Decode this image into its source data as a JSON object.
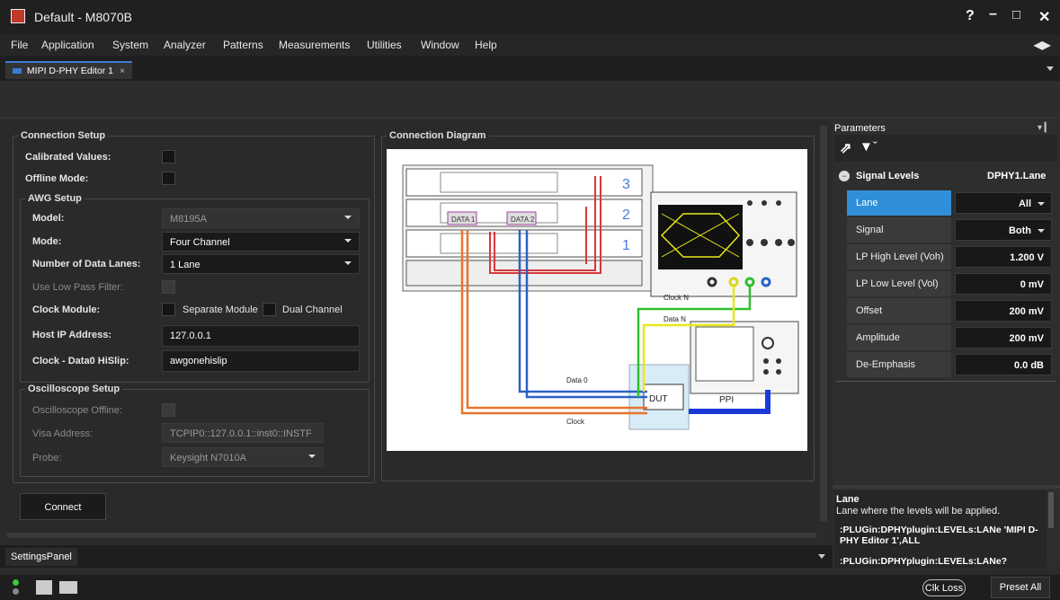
{
  "window": {
    "title": "Default - M8070B",
    "help": "?",
    "minimize": "–",
    "maximize": "□",
    "close": "✕"
  },
  "menu": [
    "File",
    "Application",
    "System",
    "Analyzer",
    "Patterns",
    "Measurements",
    "Utilities",
    "Window",
    "Help"
  ],
  "tab": {
    "label": "MIPI D-PHY Editor 1",
    "close": "×"
  },
  "connection_setup": {
    "title": "Connection Setup",
    "calibrated_label": "Calibrated Values:",
    "offline_label": "Offline Mode:",
    "awg": {
      "title": "AWG Setup",
      "model_label": "Model:",
      "model_value": "M8195A",
      "mode_label": "Mode:",
      "mode_value": "Four Channel",
      "lanes_label": "Number of Data Lanes:",
      "lanes_value": "1 Lane",
      "lowpass_label": "Use Low Pass Filter:",
      "clock_label": "Clock Module:",
      "separate_module": "Separate Module",
      "dual_channel": "Dual Channel",
      "host_label": "Host IP Address:",
      "host_value": "127.0.0.1",
      "hislip_label": "Clock - Data0 HiSlip:",
      "hislip_value": "awgonehislip"
    },
    "scope": {
      "title": "Oscilloscope Setup",
      "offline_label": "Oscilloscope Offline:",
      "visa_label": "Visa Address:",
      "visa_value": "TCPIP0::127.0.0.1::inst0::INSTF",
      "probe_label": "Probe:",
      "probe_value": "Keysight N7010A"
    },
    "connect_label": "Connect"
  },
  "diagram": {
    "title": "Connection Diagram",
    "data1": "DATA 1",
    "data2": "DATA 2",
    "clock_n": "Clock N",
    "data_n": "Data N",
    "data_0": "Data 0",
    "clock": "Clock",
    "dut": "DUT",
    "ppi": "PPI",
    "rack_numbers": [
      "3",
      "2",
      "1"
    ]
  },
  "parameters": {
    "title": "Parameters",
    "section": "Signal Levels",
    "section_value": "DPHY1.Lane",
    "rows": [
      {
        "name": "Lane",
        "value": "All"
      },
      {
        "name": "Signal",
        "value": "Both"
      },
      {
        "name": "LP High Level (Voh)",
        "value": "1.200 V"
      },
      {
        "name": "LP Low Level (Vol)",
        "value": "0 mV"
      },
      {
        "name": "Offset",
        "value": "200 mV"
      },
      {
        "name": "Amplitude",
        "value": "200 mV"
      },
      {
        "name": "De-Emphasis",
        "value": "0.0 dB"
      }
    ],
    "help_title": "Lane",
    "help_text": "Lane where the levels will be applied.",
    "help_cmd1": ":PLUGin:DPHYplugin:LEVELs:LANe 'MIPI D-PHY Editor 1',ALL",
    "help_cmd2": ":PLUGin:DPHYplugin:LEVELs:LANe?"
  },
  "settings_panel": "SettingsPanel",
  "status": {
    "clk_loss": "Clk Loss",
    "preset_all": "Preset All"
  },
  "colors": {
    "accent": "#2f8fd8",
    "clock": "#e8742a",
    "data0": "#2a62c9",
    "datan": "#e8e81a",
    "clockn": "#2ec02e",
    "red": "#d83838"
  }
}
